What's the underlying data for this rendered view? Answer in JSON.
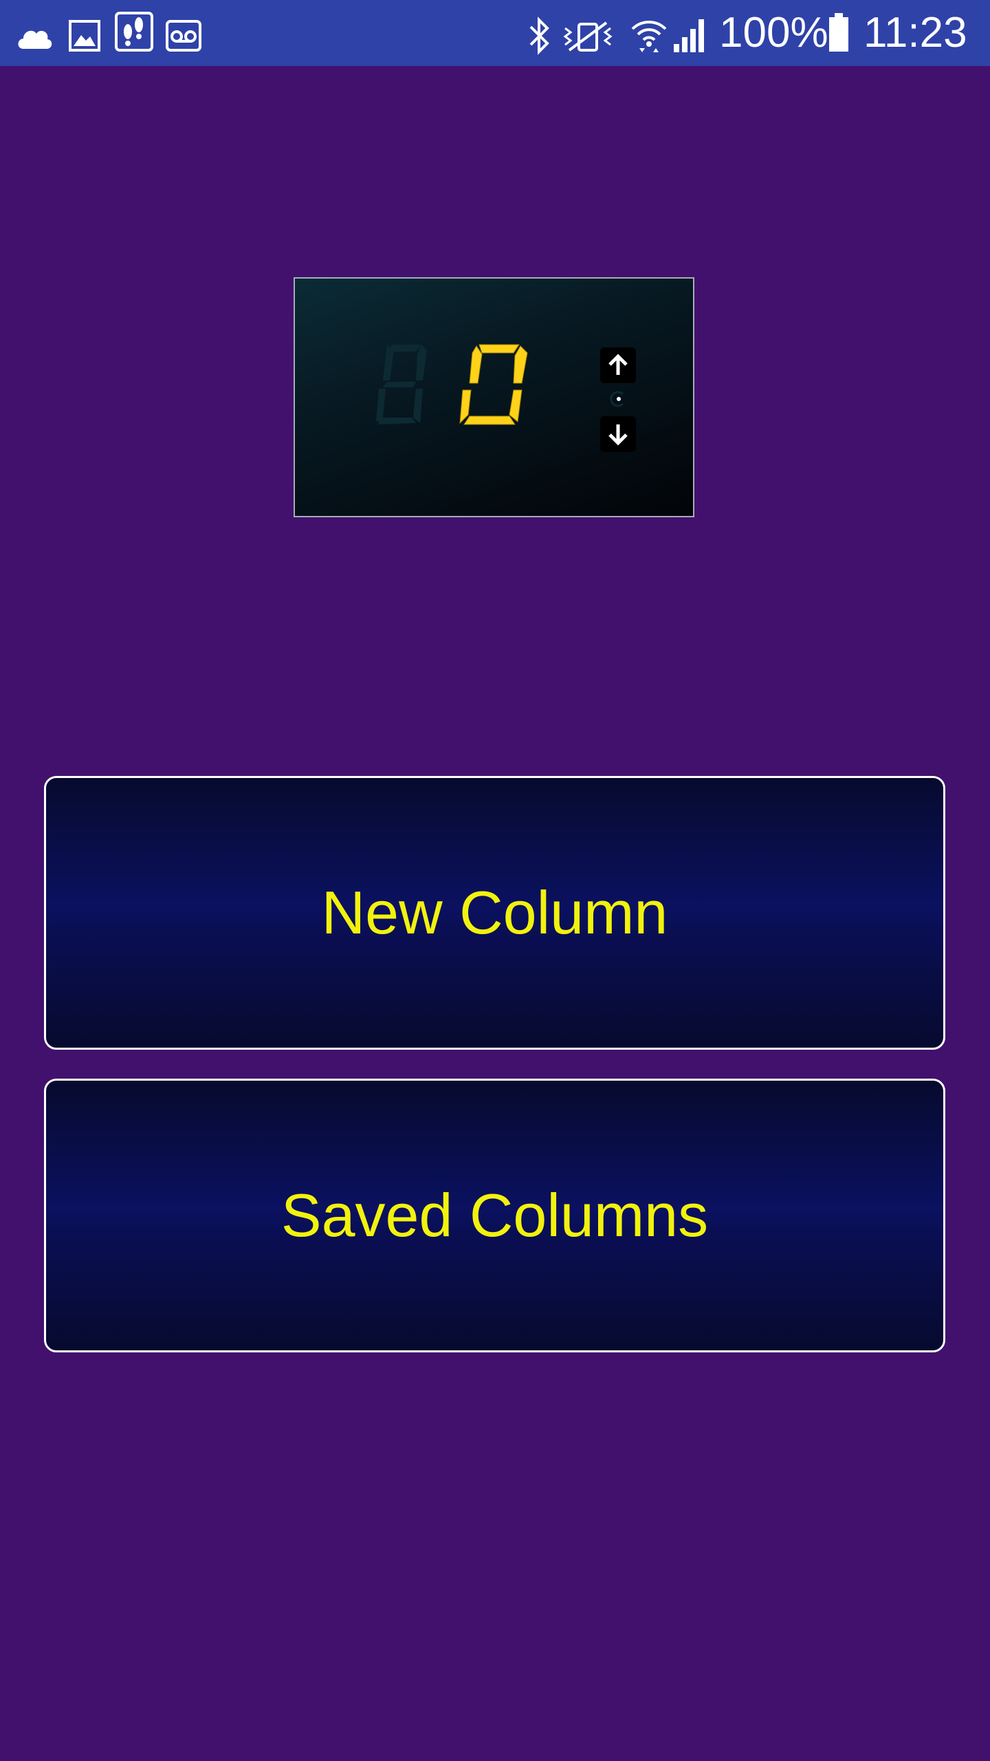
{
  "status_bar": {
    "battery_text": "100%",
    "time_text": "11:23",
    "left_icons": [
      "cloud-icon",
      "image-icon",
      "footsteps-icon",
      "voicemail-icon"
    ],
    "right_icons": [
      "bluetooth-icon",
      "vibrate-icon",
      "wifi-icon",
      "signal-icon",
      "battery-icon"
    ],
    "background": "#2f42a8"
  },
  "display": {
    "value": "0",
    "active_color": "#ffd21a",
    "inactive_color": "#0d2a33"
  },
  "buttons": {
    "new_column_label": "New Column",
    "saved_columns_label": "Saved Columns",
    "label_color": "#f2f20e"
  },
  "background_color": "#42116e"
}
